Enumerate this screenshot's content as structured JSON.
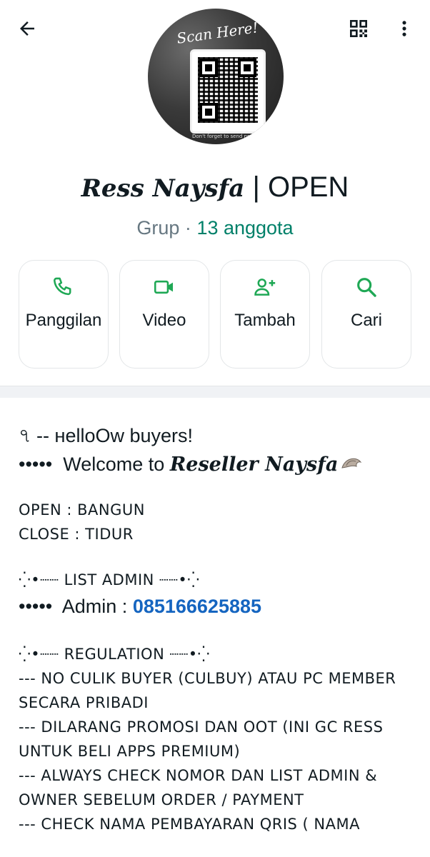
{
  "header": {
    "back_icon": "arrow-left-icon",
    "qr_icon": "qr-code-icon",
    "menu_icon": "more-vertical-icon"
  },
  "avatar": {
    "scan_text": "Scan Here!",
    "caption": "Don't forget to send proof"
  },
  "group": {
    "name_script": "Ress Naysfa",
    "name_suffix": " | OPEN",
    "type": "Grup · ",
    "members": "13 anggota"
  },
  "actions": [
    {
      "label": "Panggilan",
      "icon": "phone-icon"
    },
    {
      "label": "Video",
      "icon": "video-icon"
    },
    {
      "label": "Tambah",
      "icon": "add-person-icon"
    },
    {
      "label": "Cari",
      "icon": "search-icon"
    }
  ],
  "description": {
    "greeting": "৭ -- ʜelloOw buyers!",
    "welcome_prefix": "•••••  Welcome to ",
    "welcome_script": "Reseller Naysfa",
    "open_line": "OPEN : BANGUN",
    "close_line": "CLOSE : TIDUR",
    "list_admin_header": "⁛•┈┈ LIST ADMIN ┈┈•⁛",
    "admin_prefix": "•••••  Admin : ",
    "admin_phone": "085166625885",
    "regulation_header": "⁛•┈┈ REGULATION ┈┈•⁛",
    "rules": [
      "--- NO CULIK BUYER (CULBUY) ATAU PC MEMBER SECARA PRIBADI",
      "--- DILARANG PROMOSI DAN OOT (INI GC RESS UNTUK BELI APPS PREMIUM)",
      "--- ALWAYS CHECK NOMOR DAN LIST ADMIN & OWNER SEBELUM ORDER / PAYMENT",
      "--- CHECK NAMA PEMBAYARAN QRIS ( NAMA"
    ]
  },
  "colors": {
    "accent_green": "#008069",
    "link_blue": "#1565c0",
    "secondary_text": "#667781"
  }
}
